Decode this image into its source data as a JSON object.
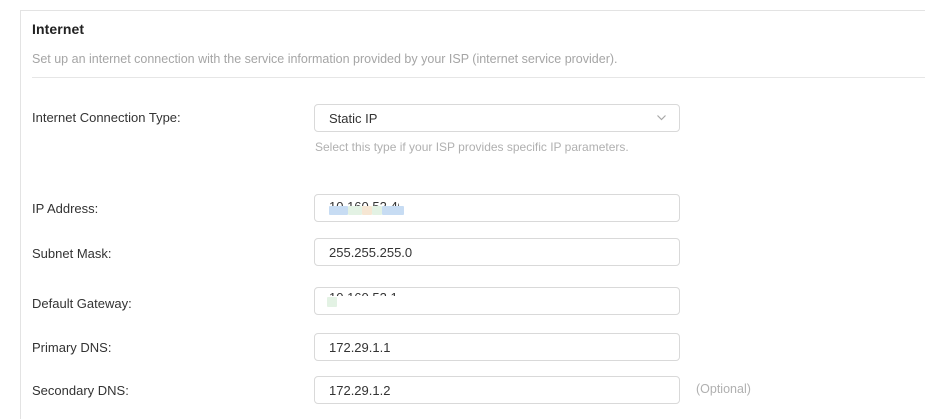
{
  "section": {
    "title": "Internet",
    "description": "Set up an internet connection with the service information provided by your ISP (internet service provider)."
  },
  "form": {
    "connection_type": {
      "label": "Internet Connection Type:",
      "value": "Static IP",
      "hint": "Select this type if your ISP provides specific IP parameters.",
      "icon": "chevron-down-icon"
    },
    "ip_address": {
      "label": "IP Address:"
    },
    "subnet_mask": {
      "label": "Subnet Mask:",
      "value": "255.255.255.0"
    },
    "default_gateway": {
      "label": "Default Gateway:"
    },
    "primary_dns": {
      "label": "Primary DNS:",
      "value": "172.29.1.1"
    },
    "secondary_dns": {
      "label": "Secondary DNS:",
      "value": "172.29.1.2",
      "suffix": "(Optional)"
    }
  },
  "colors": {
    "redaction_blue": "#c7dcf3",
    "redaction_green": "#e3f2e4",
    "redaction_orange": "#f6e6d3"
  }
}
